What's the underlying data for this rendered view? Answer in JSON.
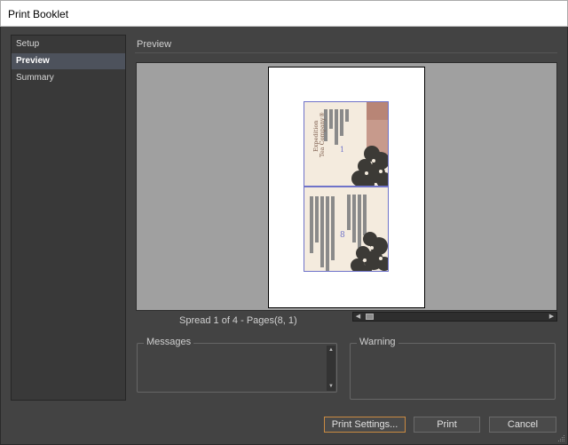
{
  "window": {
    "title": "Print Booklet"
  },
  "sidebar": {
    "items": [
      {
        "label": "Setup",
        "active": false
      },
      {
        "label": "Preview",
        "active": true
      },
      {
        "label": "Summary",
        "active": false
      }
    ]
  },
  "preview": {
    "section_title": "Preview",
    "spread_label": "Spread 1 of 4 - Pages(8, 1)",
    "thumbnail": {
      "brand_line1": "Expedition",
      "brand_line2": "Tea Company®",
      "page_number_top": "1",
      "page_number_bottom": "8",
      "page_border_color": "#6f73c9"
    }
  },
  "messages": {
    "legend": "Messages"
  },
  "warning": {
    "legend": "Warning"
  },
  "buttons": {
    "print_settings": "Print Settings...",
    "print": "Print",
    "cancel": "Cancel"
  },
  "colors": {
    "dialog_bg": "#434343",
    "focus_border": "#c98a42",
    "active_item_bg": "#4d525c"
  }
}
